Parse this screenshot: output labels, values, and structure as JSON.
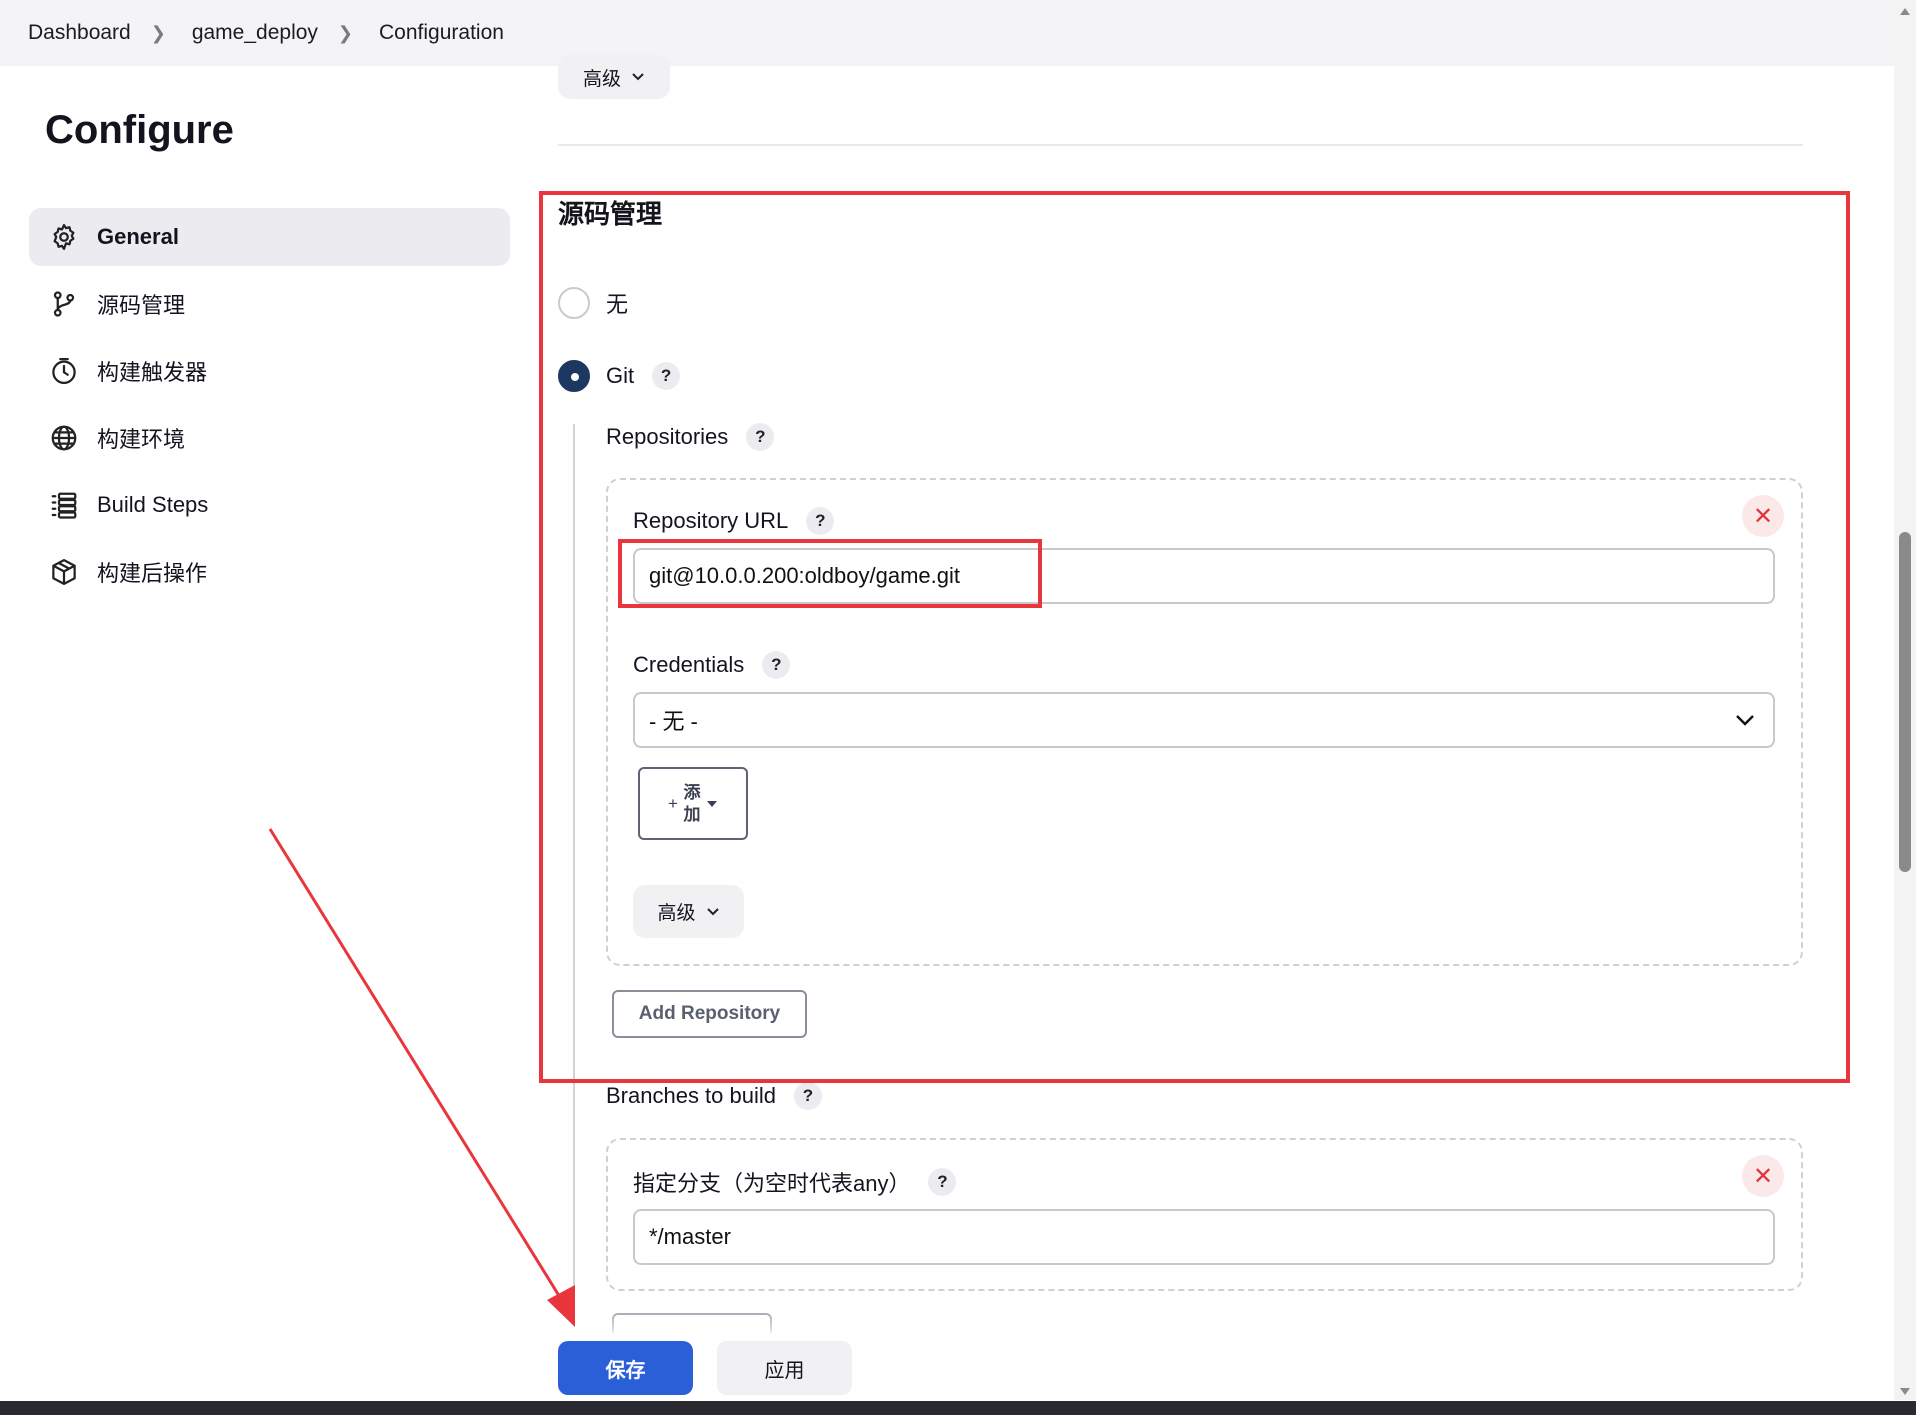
{
  "breadcrumb": {
    "items": [
      "Dashboard",
      "game_deploy",
      "Configuration"
    ]
  },
  "page": {
    "title": "Configure"
  },
  "sidebar": {
    "items": [
      {
        "label": "General",
        "icon": "gear-icon",
        "active": true
      },
      {
        "label": "源码管理",
        "icon": "branch-icon"
      },
      {
        "label": "构建触发器",
        "icon": "clock-icon"
      },
      {
        "label": "构建环境",
        "icon": "globe-icon"
      },
      {
        "label": "Build Steps",
        "icon": "list-icon"
      },
      {
        "label": "构建后操作",
        "icon": "package-icon"
      }
    ]
  },
  "top_advanced": {
    "label": "高级"
  },
  "scm": {
    "title": "源码管理",
    "option_none": "无",
    "option_git": "Git",
    "selected": "Git",
    "repositories_label": "Repositories",
    "repository_url_label": "Repository URL",
    "repository_url_value": "git@10.0.0.200:oldboy/game.git",
    "credentials_label": "Credentials",
    "credentials_value": "- 无 -",
    "add_button_label": "添加",
    "advanced_label": "高级",
    "add_repository_label": "Add Repository",
    "branches_label": "Branches to build",
    "branch_specifier_label": "指定分支（为空时代表any）",
    "branch_specifier_value": "*/master"
  },
  "footer": {
    "save_label": "保存",
    "apply_label": "应用"
  },
  "colors": {
    "accent": "#2b5fd8",
    "annotation": "#e8363c",
    "radio_checked": "#1c3761"
  }
}
